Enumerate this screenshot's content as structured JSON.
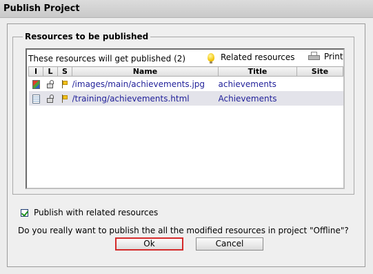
{
  "window": {
    "title": "Publish Project"
  },
  "resources_group": {
    "legend": "Resources to be published"
  },
  "panel": {
    "title": "These resources will get published (2)",
    "related_label": "Related resources",
    "print_label": "Print"
  },
  "table": {
    "columns": [
      "I",
      "L",
      "S",
      "Name",
      "Title",
      "Site"
    ],
    "rows": [
      {
        "icon": "image-file-icon",
        "name": "/images/main/achievements.jpg",
        "title": "achievements",
        "site": ""
      },
      {
        "icon": "text-file-icon",
        "name": "/training/achievements.html",
        "title": "Achievements",
        "site": ""
      }
    ]
  },
  "options": {
    "publish_related_label": "Publish with related resources",
    "publish_related_checked": true
  },
  "confirm": {
    "question": "Do you really want to publish the all the modified resources in project \"Offline\"?"
  },
  "buttons": {
    "ok": "Ok",
    "cancel": "Cancel"
  },
  "colors": {
    "link": "#1f1f99",
    "ok_focus_border": "#d42a2a",
    "alt_row": "#e3e3ea"
  }
}
